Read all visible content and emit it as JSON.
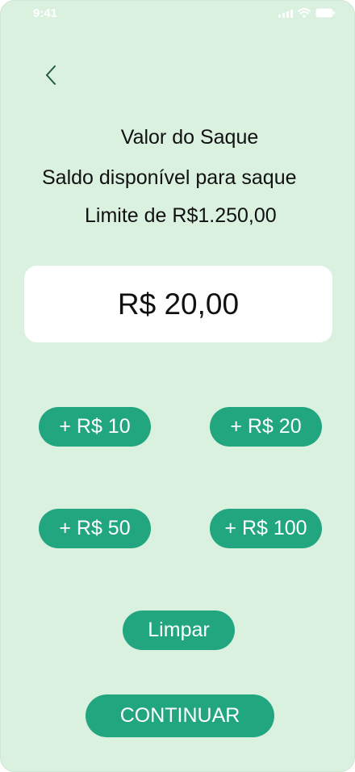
{
  "status_bar": {
    "time": "9:41"
  },
  "header": {
    "back_icon": "chevron-left-icon"
  },
  "title": "Valor do Saque",
  "subtitle": "Saldo disponível para saque",
  "limit_text": "Limite de R$1.250,00",
  "amount": "R$ 20,00",
  "quick_add": [
    {
      "label": "+ R$ 10"
    },
    {
      "label": "+ R$ 20"
    },
    {
      "label": "+ R$ 50"
    },
    {
      "label": "+ R$ 100"
    }
  ],
  "clear_label": "Limpar",
  "continue_label": "CONTINUAR",
  "colors": {
    "background": "#daf1df",
    "accent": "#22a67f",
    "card": "#ffffff"
  }
}
